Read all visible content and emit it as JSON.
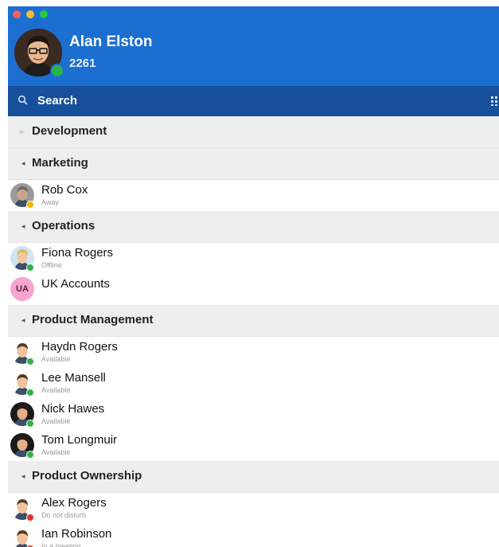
{
  "user": {
    "name": "Alan Elston",
    "extension": "2261",
    "presence_color": "#2db24a"
  },
  "search": {
    "label": "Search"
  },
  "colors": {
    "header": "#1c6fd1",
    "search_bar": "#16509b",
    "group_bg": "#eeeeee"
  },
  "groups": [
    {
      "name": "Development",
      "expanded": false,
      "contacts": []
    },
    {
      "name": "Marketing",
      "expanded": true,
      "contacts": [
        {
          "name": "Rob Cox",
          "status": "Away",
          "status_color": "#f4b400",
          "avatar": "photo-grey"
        }
      ]
    },
    {
      "name": "Operations",
      "expanded": true,
      "contacts": [
        {
          "name": "Fiona Rogers",
          "status": "Offline",
          "status_color": "#2db24a",
          "avatar": "female-cartoon"
        },
        {
          "name": "UK Accounts",
          "status": "",
          "status_color": "",
          "avatar": "initials",
          "initials": "UA"
        }
      ]
    },
    {
      "name": "Product Management",
      "expanded": true,
      "contacts": [
        {
          "name": "Haydn Rogers",
          "status": "Available",
          "status_color": "#2db24a",
          "avatar": "male-cartoon"
        },
        {
          "name": "Lee Mansell",
          "status": "Available",
          "status_color": "#2db24a",
          "avatar": "male-cartoon"
        },
        {
          "name": "Nick Hawes",
          "status": "Available",
          "status_color": "#2db24a",
          "avatar": "male-dark"
        },
        {
          "name": "Tom Longmuir",
          "status": "Available",
          "status_color": "#2db24a",
          "avatar": "male-dark"
        }
      ]
    },
    {
      "name": "Product Ownership",
      "expanded": true,
      "contacts": [
        {
          "name": "Alex Rogers",
          "status": "Do not disturb",
          "status_color": "#e0342d",
          "avatar": "male-cartoon"
        },
        {
          "name": "Ian Robinson",
          "status": "In a meeting",
          "status_color": "#e0342d",
          "avatar": "male-cartoon"
        }
      ]
    }
  ]
}
